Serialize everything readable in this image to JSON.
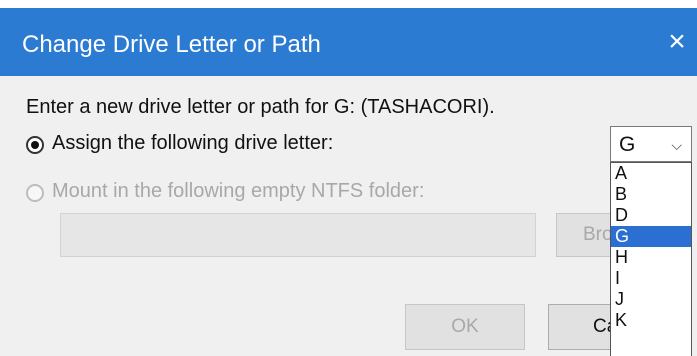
{
  "window": {
    "title": "Change Drive Letter or Path",
    "close_glyph": "×",
    "title_color": "#2b7bd3"
  },
  "prompt": "Enter a new drive letter or path for G: (TASHACORI).",
  "options": {
    "assign_label": "Assign the following drive letter:",
    "assign_selected": true,
    "mount_label": "Mount in the following empty NTFS folder:",
    "mount_enabled": false
  },
  "mount_path": {
    "value": ""
  },
  "buttons": {
    "browse_label": "Bro",
    "ok_label": "OK",
    "cancel_label": "Ca"
  },
  "drive_select": {
    "value": "G",
    "chevron_icon": "chevron-down-icon",
    "options": [
      "A",
      "B",
      "D",
      "G",
      "H",
      "I",
      "J",
      "K"
    ],
    "highlighted": "G",
    "highlight_color": "#2b6fd2"
  }
}
